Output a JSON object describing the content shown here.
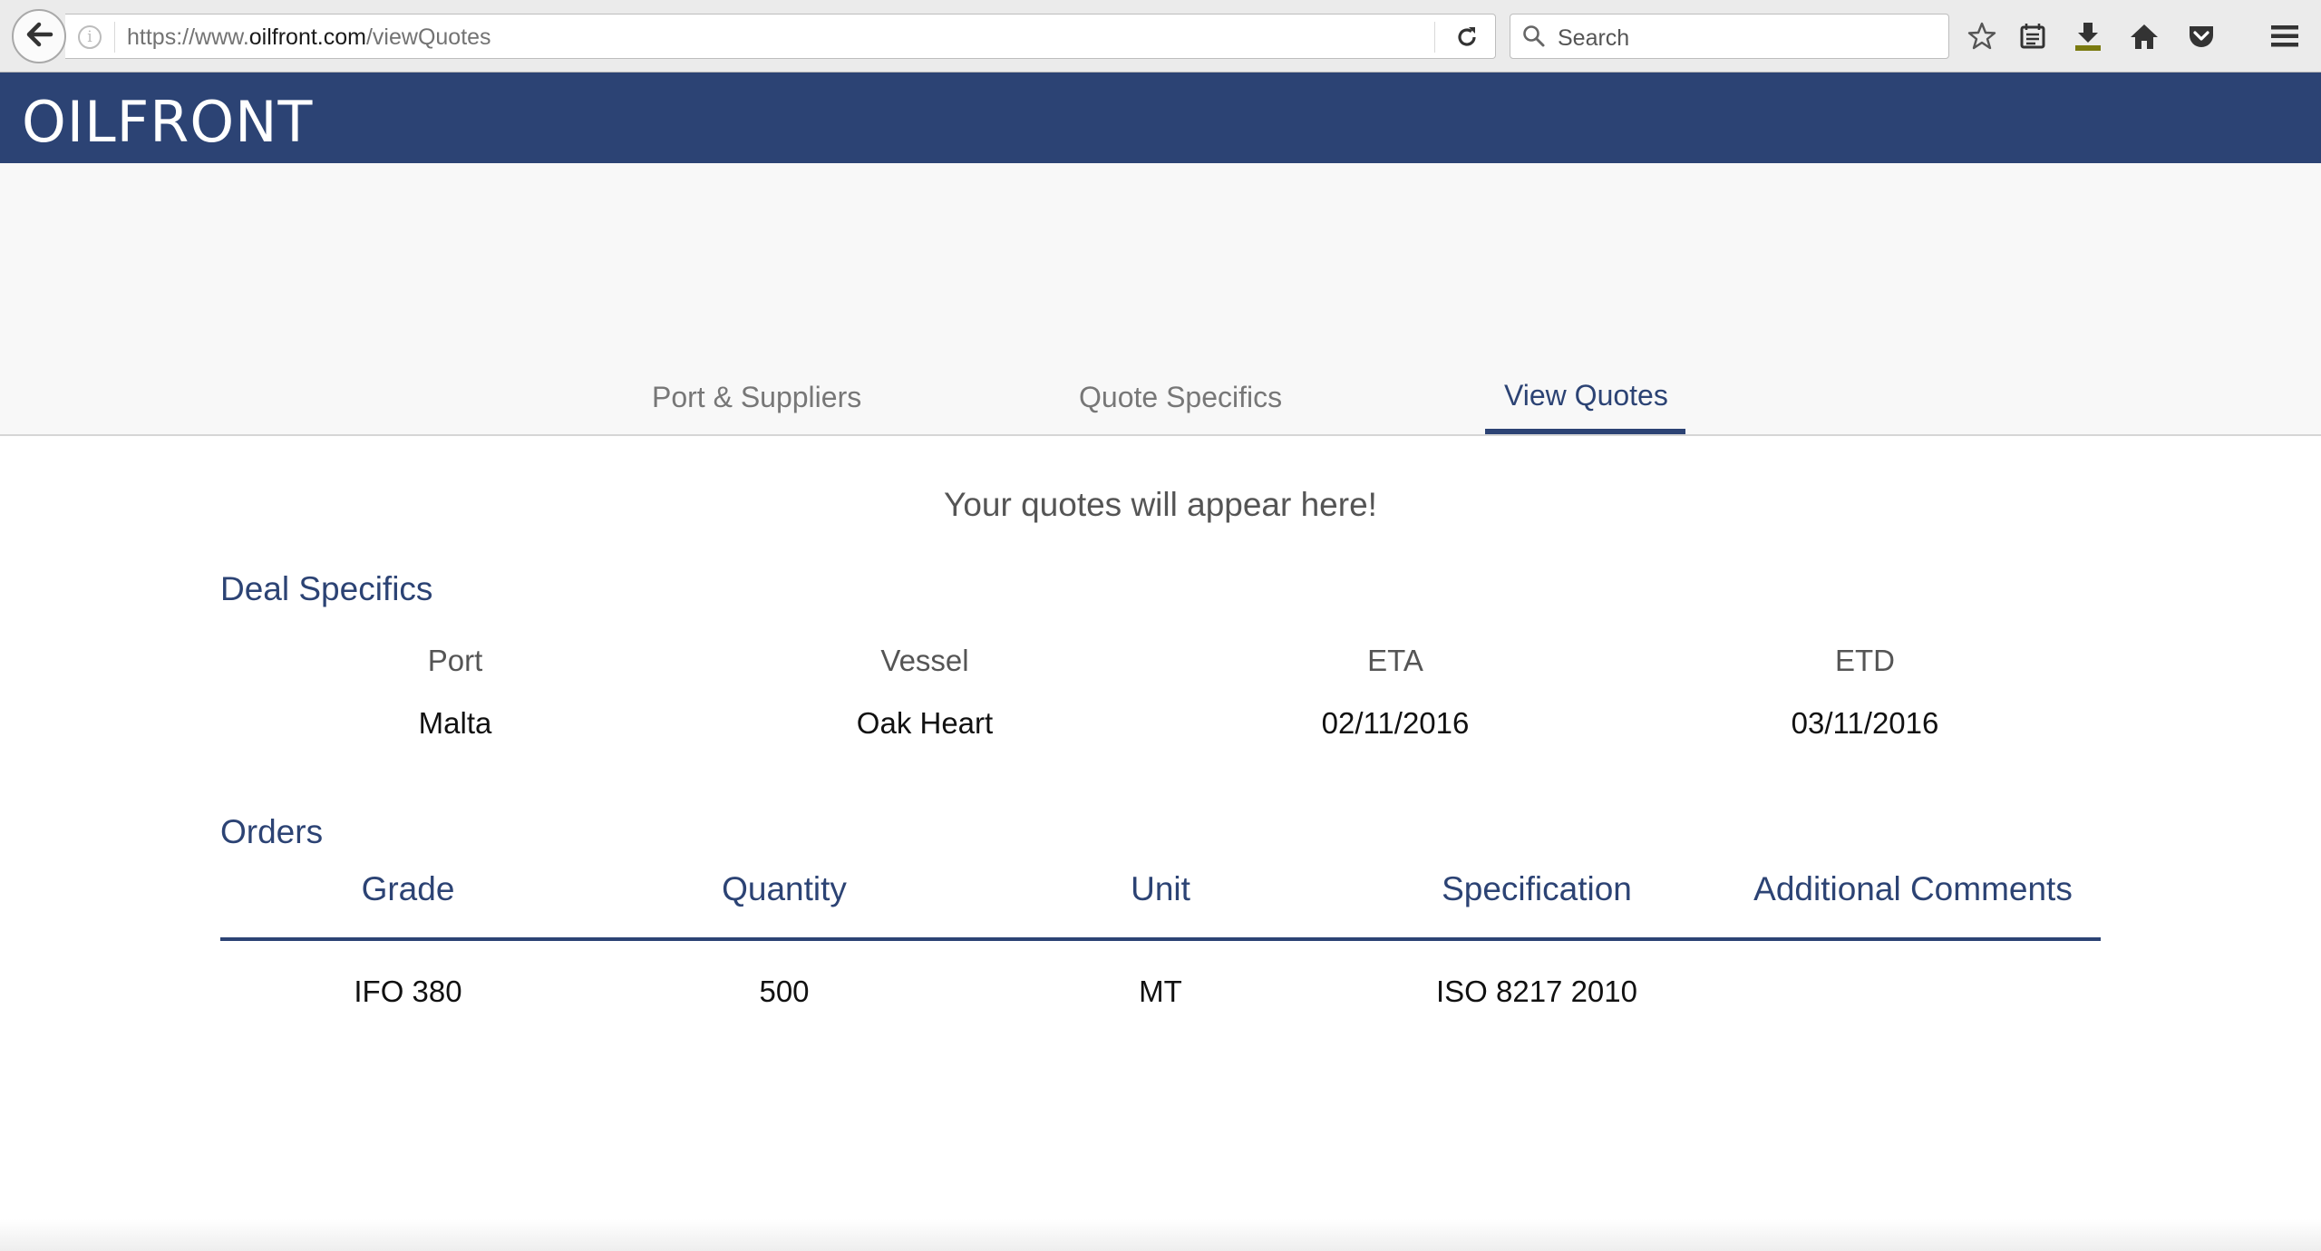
{
  "browser": {
    "url_prefix": "https://www.",
    "url_host": "oilfront.com",
    "url_path": "/viewQuotes",
    "search_placeholder": "Search",
    "icons": [
      "back-arrow-icon",
      "info-icon",
      "reload-icon",
      "search-icon",
      "star-icon",
      "reading-list-icon",
      "download-icon",
      "home-icon",
      "pocket-icon",
      "hamburger-menu-icon"
    ]
  },
  "header": {
    "logo": "OILFRONT",
    "background": "#2c4374"
  },
  "tabs": [
    {
      "label": "Port & Suppliers",
      "active": false
    },
    {
      "label": "Quote Specifics",
      "active": false
    },
    {
      "label": "View Quotes",
      "active": true
    }
  ],
  "main": {
    "empty_message": "Your quotes will appear here!",
    "deal": {
      "title": "Deal Specifics",
      "fields": [
        {
          "label": "Port",
          "value": "Malta"
        },
        {
          "label": "Vessel",
          "value": "Oak Heart"
        },
        {
          "label": "ETA",
          "value": "02/11/2016"
        },
        {
          "label": "ETD",
          "value": "03/11/2016"
        }
      ]
    },
    "orders": {
      "title": "Orders",
      "columns": [
        "Grade",
        "Quantity",
        "Unit",
        "Specification",
        "Additional Comments"
      ],
      "rows": [
        [
          "IFO 380",
          "500",
          "MT",
          "ISO 8217 2010",
          ""
        ]
      ]
    }
  },
  "colors": {
    "accent": "#2c4374",
    "muted_text": "#777777"
  }
}
